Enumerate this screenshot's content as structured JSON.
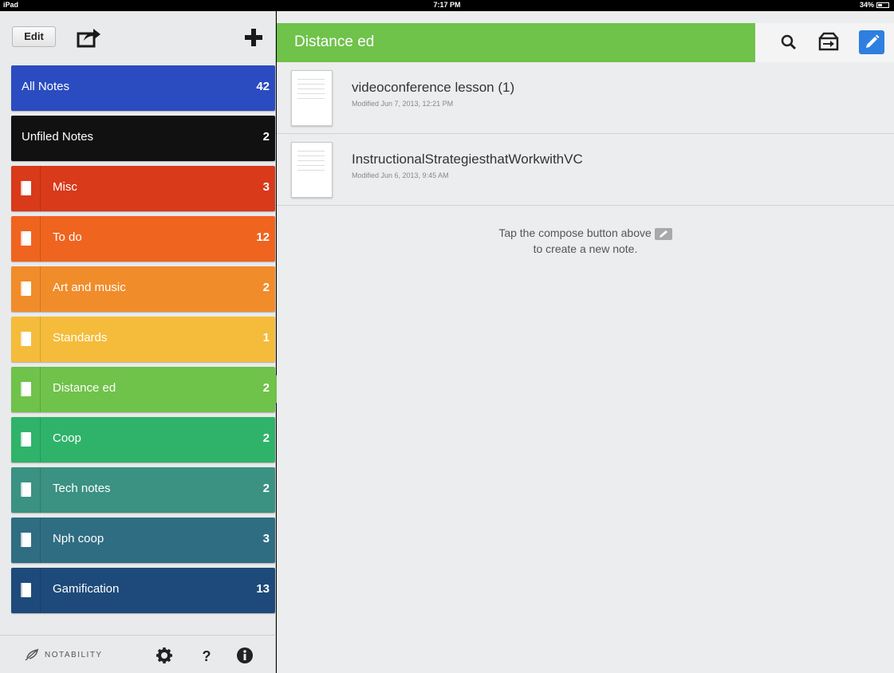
{
  "status_bar": {
    "device": "iPad",
    "time": "7:17 PM",
    "battery": "34%"
  },
  "sidebar": {
    "edit_label": "Edit",
    "notebooks": [
      {
        "name": "All Notes",
        "count": "42",
        "color": "#2a4cc0",
        "icon": false
      },
      {
        "name": "Unfiled Notes",
        "count": "2",
        "color": "#111111",
        "icon": false
      },
      {
        "name": "Misc",
        "count": "3",
        "color": "#d83a1a",
        "icon": true
      },
      {
        "name": "To do",
        "count": "12",
        "color": "#ef641f",
        "icon": true
      },
      {
        "name": "Art and music",
        "count": "2",
        "color": "#f18c2b",
        "icon": true
      },
      {
        "name": "Standards",
        "count": "1",
        "color": "#f4bc3a",
        "icon": true
      },
      {
        "name": "Distance ed",
        "count": "2",
        "color": "#6fc24a",
        "icon": true,
        "selected": true
      },
      {
        "name": "Coop",
        "count": "2",
        "color": "#2fb36a",
        "icon": true
      },
      {
        "name": "Tech notes",
        "count": "2",
        "color": "#3b9182",
        "icon": true
      },
      {
        "name": "Nph coop",
        "count": "3",
        "color": "#2f6d82",
        "icon": true
      },
      {
        "name": "Gamification",
        "count": "13",
        "color": "#1d4a7a",
        "icon": true
      }
    ],
    "brand": "NOTABILITY"
  },
  "main": {
    "title": "Distance ed",
    "notes": [
      {
        "title": "videoconference lesson (1)",
        "modified": "Modified Jun 7, 2013, 12:21 PM"
      },
      {
        "title": "InstructionalStrategiesthatWorkwithVC",
        "modified": "Modified Jun 6, 2013, 9:45 AM"
      }
    ],
    "hint_line1": "Tap the compose button above",
    "hint_line2": "to create a new note."
  },
  "icons": {
    "share": "share-icon",
    "add": "plus-icon",
    "search": "search-icon",
    "import": "import-icon",
    "compose": "compose-icon",
    "settings": "gear-icon",
    "help": "help-icon",
    "info": "info-icon",
    "notebook": "notebook-icon"
  }
}
